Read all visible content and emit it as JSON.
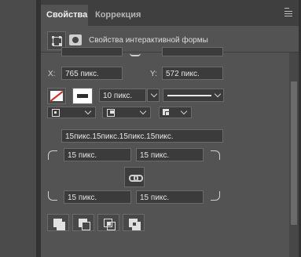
{
  "tabs": [
    {
      "label": "Свойства",
      "active": true
    },
    {
      "label": "Коррекция",
      "active": false
    }
  ],
  "header": {
    "title": "Свойства интерактивной формы"
  },
  "position": {
    "x_label": "X:",
    "x_value": "765 пикс.",
    "y_label": "Y:",
    "y_value": "572 пикс."
  },
  "stroke": {
    "width_value": "10 пикс.",
    "fill_color": "#ffffff",
    "stroke_color": "#ffffff"
  },
  "corners": {
    "all_value": "15пикс.15пикс.15пикс.15пикс.",
    "top_left": "15 пикс.",
    "top_right": "15 пикс.",
    "bottom_left": "15 пикс.",
    "bottom_right": "15 пикс."
  },
  "icons": {
    "menu": "panel-menu-icon",
    "shape": "vector-shape-icon",
    "mask": "mask-icon",
    "link": "link-icon"
  }
}
